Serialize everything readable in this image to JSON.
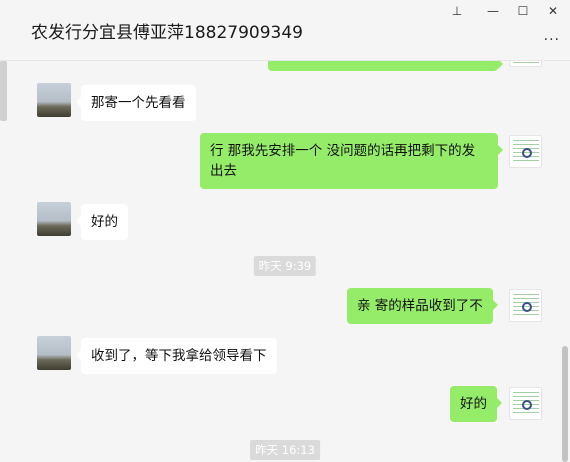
{
  "window": {
    "title": "农发行分宜县傅亚萍18827909349",
    "controls": {
      "pin": "⊥",
      "minimize": "—",
      "maximize": "☐",
      "close": "✕"
    },
    "more": "···"
  },
  "messages": [
    {
      "side": "in",
      "text": "那寄一个先看看"
    },
    {
      "side": "out",
      "text": "行 那我先安排一个  没问题的话再把剩下的发出去"
    },
    {
      "side": "in",
      "text": "好的"
    },
    {
      "type": "timestamp",
      "text": "昨天 9:39"
    },
    {
      "side": "out",
      "text": "亲 寄的样品收到了不"
    },
    {
      "side": "in",
      "text": "收到了，等下我拿给领导看下"
    },
    {
      "side": "out",
      "text": "好的"
    },
    {
      "type": "timestamp",
      "text": "昨天 16:13"
    }
  ],
  "colors": {
    "outgoing_bubble": "#95ec69",
    "incoming_bubble": "#ffffff",
    "background": "#f5f5f5"
  }
}
